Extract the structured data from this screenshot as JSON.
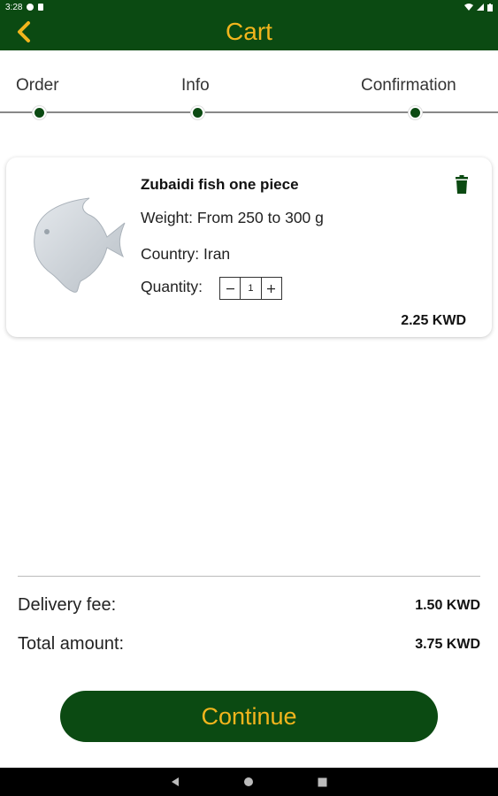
{
  "status_bar": {
    "time": "3:28"
  },
  "app_bar": {
    "title": "Cart",
    "back_icon": "chevron-left-icon",
    "accent_color": "#f2b51d",
    "brand_color": "#0b4a12"
  },
  "stepper": {
    "steps": [
      {
        "label": "Order"
      },
      {
        "label": "Info"
      },
      {
        "label": "Confirmation"
      }
    ]
  },
  "cart": {
    "items": [
      {
        "name": "Zubaidi fish one piece",
        "weight": "Weight: From 250 to 300 g",
        "country": "Country: Iran",
        "quantity_label": "Quantity:",
        "quantity": "1",
        "price": "2.25 KWD",
        "image": "fish-icon",
        "delete_icon": "trash-icon"
      }
    ]
  },
  "summary": {
    "delivery_label": "Delivery fee:",
    "delivery_value": "1.50 KWD",
    "total_label": "Total amount:",
    "total_value": "3.75 KWD"
  },
  "actions": {
    "continue_label": "Continue"
  },
  "nav_bar": {
    "icons": [
      "back-icon",
      "home-icon",
      "recents-icon"
    ]
  }
}
